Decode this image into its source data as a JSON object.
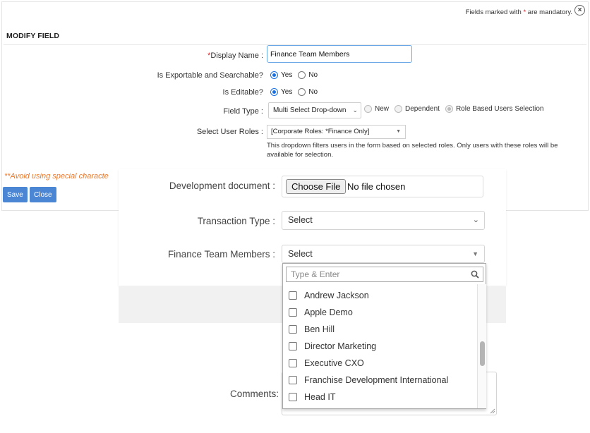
{
  "header": {
    "mandatory_note_prefix": "Fields marked with ",
    "mandatory_star": "*",
    "mandatory_note_suffix": " are mandatory.",
    "close_glyph": "×",
    "section_title": "MODIFY FIELD"
  },
  "form": {
    "display_name": {
      "star": "*",
      "label": "Display Name :",
      "value": "Finance Team Members"
    },
    "exportable": {
      "label": "Is Exportable and Searchable?",
      "options": [
        "Yes",
        "No"
      ],
      "selected": "Yes"
    },
    "editable": {
      "label": "Is Editable?",
      "options": [
        "Yes",
        "No"
      ],
      "selected": "Yes"
    },
    "field_type": {
      "label": "Field Type :",
      "value": "Multi Select Drop-down",
      "radio_options": [
        "New",
        "Dependent",
        "Role Based Users Selection"
      ],
      "selected_radio": "Role Based Users Selection"
    },
    "user_roles": {
      "label": "Select User Roles :",
      "value": "[Corporate Roles: *Finance Only]",
      "help": "This dropdown filters users in the form based on selected roles. Only users with these roles will be available for selection."
    },
    "avoid_note": "**Avoid using special characte",
    "save_label": "Save",
    "close_label": "Close"
  },
  "overlay": {
    "development_document": {
      "label": "Development document :",
      "button": "Choose File",
      "status": "No file chosen"
    },
    "transaction_type": {
      "label": "Transaction Type :",
      "value": "Select"
    },
    "finance_team_members": {
      "label": "Finance Team Members :",
      "value": "Select",
      "search_placeholder": "Type & Enter",
      "options": [
        "Andrew Jackson",
        "Apple Demo",
        "Ben Hill",
        "Director Marketing",
        "Executive CXO",
        "Franchise Development International",
        "Head IT"
      ]
    },
    "comments": {
      "label": "Comments:"
    }
  },
  "colors": {
    "accent": "#4a86d4",
    "mandatory": "#e0202a",
    "warning": "#e8782c",
    "focus": "#6aa7e6"
  }
}
